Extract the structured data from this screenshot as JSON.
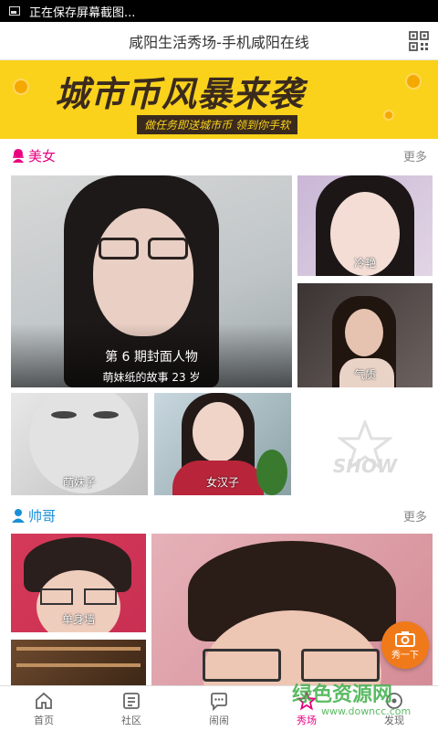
{
  "status_bar": {
    "text": "正在保存屏幕截图..."
  },
  "header": {
    "title": "咸阳生活秀场-手机咸阳在线"
  },
  "banner": {
    "main": "城市币风暴来袭",
    "sub": "做任务即送城市币 领到你手软"
  },
  "beauty_section": {
    "title": "美女",
    "more": "更多",
    "feature_title": "第 6 期封面人物",
    "feature_sub": "萌妹纸的故事 23 岁",
    "tiles": [
      "冷艳",
      "气质",
      "萌妹子",
      "女汉子"
    ],
    "show_logo": "SHOW"
  },
  "handsome_section": {
    "title": "帅哥",
    "more": "更多",
    "tiles": [
      "单身墙"
    ]
  },
  "fab": {
    "label": "秀一下"
  },
  "nav": {
    "items": [
      "首页",
      "社区",
      "闹闹",
      "秀场",
      "发现"
    ]
  },
  "watermark": {
    "text": "绿色资源网",
    "url": "www.downcc.com"
  },
  "colors": {
    "accent": "#e8007f",
    "fab": "#f07a1a",
    "banner": "#fad21b"
  }
}
